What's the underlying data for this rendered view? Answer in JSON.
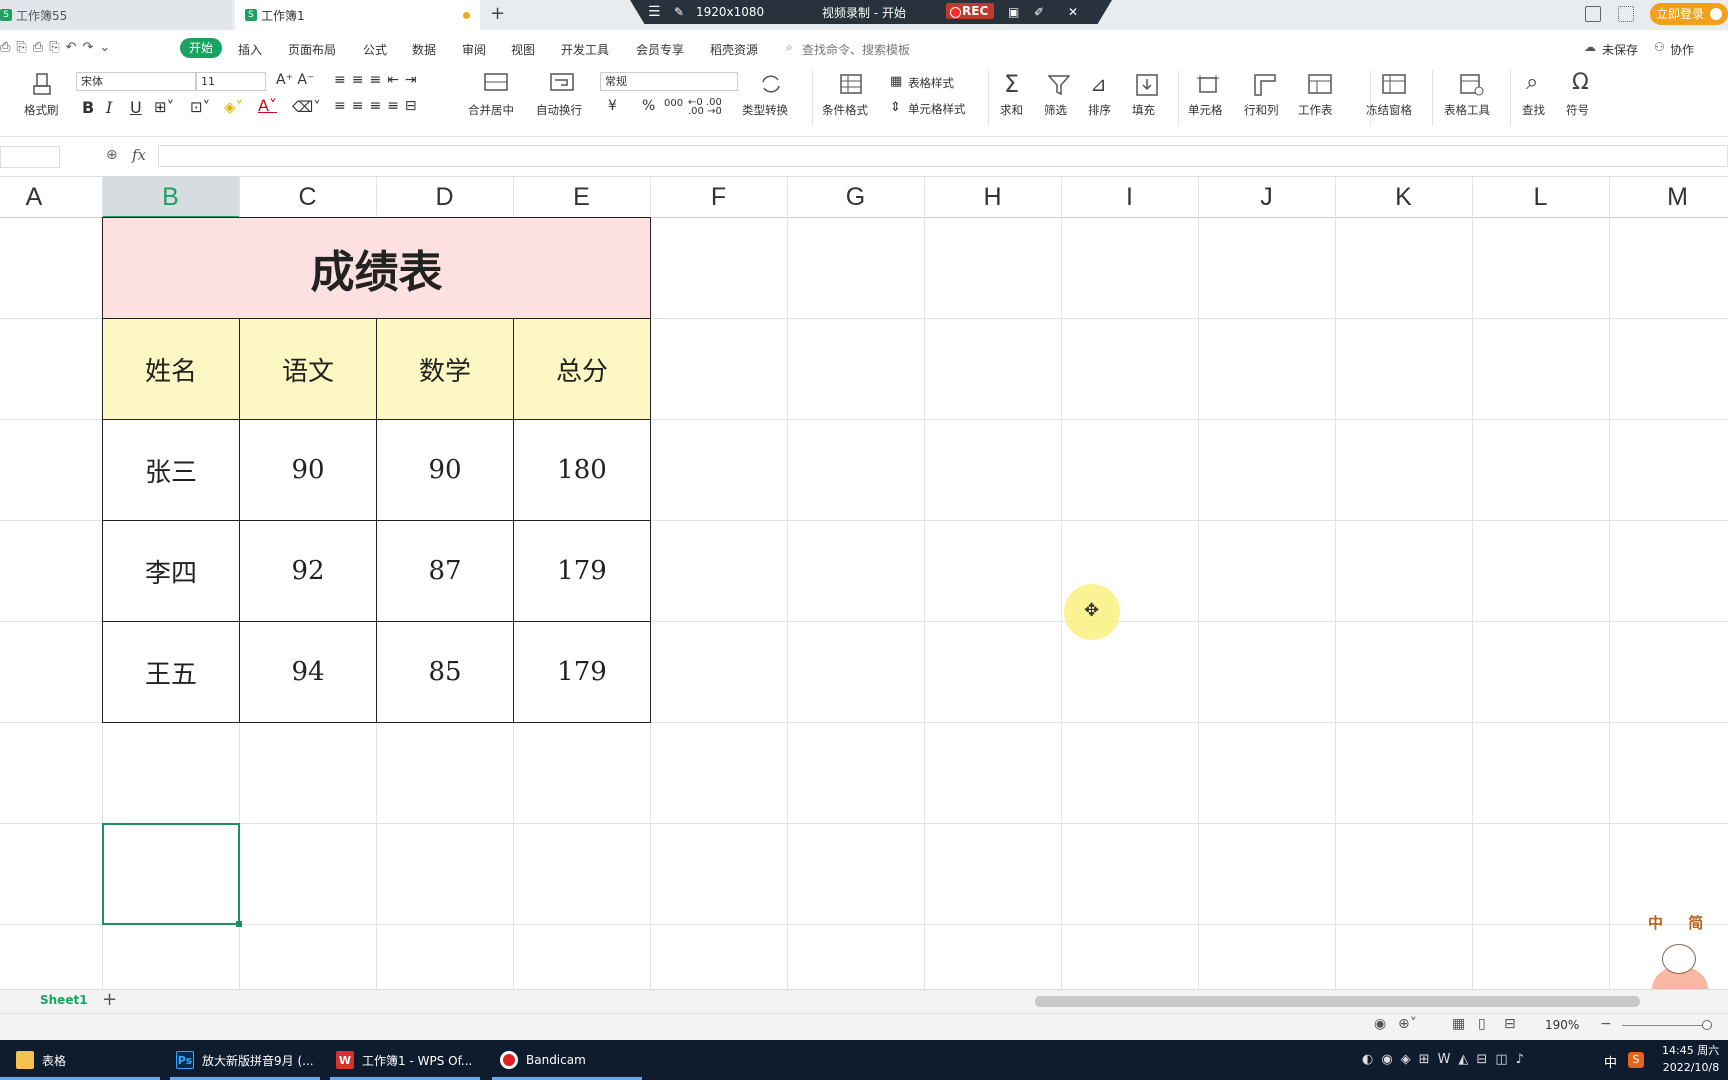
{
  "titlebar": {
    "tab_inactive": "工作簿55",
    "tab_active": "工作簿1",
    "new_tab": "+",
    "login": "立即登录"
  },
  "recorder": {
    "resolution": "1920x1080",
    "status": "视频录制 - 开始",
    "rec_label": "REC"
  },
  "menu": {
    "items": [
      "开始",
      "插入",
      "页面布局",
      "公式",
      "数据",
      "审阅",
      "视图",
      "开发工具",
      "会员专享",
      "稻壳资源"
    ],
    "search_placeholder": "查找命令、搜索模板",
    "unsaved": "未保存",
    "collab": "协作"
  },
  "ribbon": {
    "format_painter": "格式刷",
    "font_name": "宋体",
    "font_size": "11",
    "merge_center": "合并居中",
    "auto_wrap": "自动换行",
    "number_format": "常规",
    "type_convert": "类型转换",
    "cond_format": "条件格式",
    "table_style": "表格样式",
    "cell_style": "单元格样式",
    "sum": "求和",
    "filter": "筛选",
    "sort": "排序",
    "fill": "填充",
    "cell": "单元格",
    "row_col": "行和列",
    "worksheet": "工作表",
    "freeze": "冻结窗格",
    "table_tools": "表格工具",
    "find": "查找",
    "symbol": "符号",
    "bold": "B",
    "italic": "I",
    "underline": "U",
    "currency": "¥",
    "percent": "%",
    "thousands": "000"
  },
  "formula_bar": {
    "fx": "fx",
    "value": ""
  },
  "columns": [
    "A",
    "B",
    "C",
    "D",
    "E",
    "F",
    "G",
    "H",
    "I",
    "J",
    "K",
    "L",
    "M"
  ],
  "table": {
    "title": "成绩表",
    "headers": [
      "姓名",
      "语文",
      "数学",
      "总分"
    ],
    "rows": [
      [
        "张三",
        "90",
        "90",
        "180"
      ],
      [
        "李四",
        "92",
        "87",
        "179"
      ],
      [
        "王五",
        "94",
        "85",
        "179"
      ]
    ]
  },
  "sheets": {
    "active": "Sheet1",
    "add": "+"
  },
  "status": {
    "zoom": "190%"
  },
  "taskbar": {
    "items": [
      "表格",
      "放大新版拼音9月 (...",
      "工作簿1 - WPS Of...",
      "Bandicam"
    ],
    "ime": "中",
    "time": "14:45 周六",
    "date": "2022/10/8"
  },
  "watermark": {
    "text": "中 简"
  },
  "colors": {
    "accent": "#1aa260",
    "title_fill": "#fde0e0",
    "header_fill": "#fdf7c3",
    "selection": "#1e8f5f",
    "taskbar": "#0f1c2e"
  }
}
